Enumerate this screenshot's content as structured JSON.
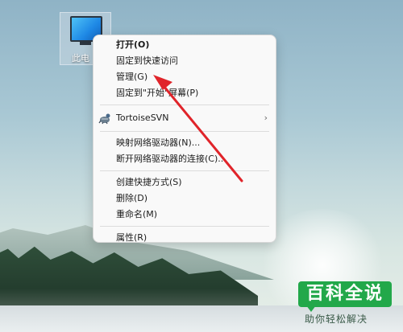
{
  "desktop": {
    "icon": {
      "name": "this-pc-icon",
      "label": "此电"
    }
  },
  "context_menu": {
    "groups": [
      {
        "items": [
          {
            "label": "打开(O)",
            "bold": true
          },
          {
            "label": "固定到快速访问"
          },
          {
            "label": "管理(G)"
          },
          {
            "label": "固定到\"开始\"屏幕(P)"
          }
        ]
      },
      {
        "items": [
          {
            "label": "TortoiseSVN",
            "icon": "tortoisesvn-icon",
            "submenu": true
          }
        ]
      },
      {
        "items": [
          {
            "label": "映射网络驱动器(N)..."
          },
          {
            "label": "断开网络驱动器的连接(C)..."
          }
        ]
      },
      {
        "items": [
          {
            "label": "创建快捷方式(S)"
          },
          {
            "label": "删除(D)"
          },
          {
            "label": "重命名(M)"
          }
        ]
      },
      {
        "items": [
          {
            "label": "属性(R)"
          }
        ]
      }
    ],
    "submenu_glyph": "›"
  },
  "annotation": {
    "arrow_color": "#e0242a",
    "target": "管理(G)"
  },
  "watermark": {
    "logo_text": "百科全说",
    "subtitle": "助你轻松解决",
    "color": "#22a84a"
  }
}
